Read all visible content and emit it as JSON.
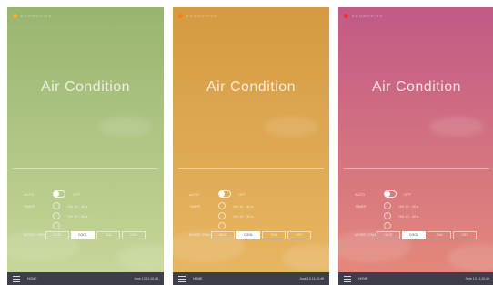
{
  "panels": [
    {
      "brand": "ECONOVIVE",
      "title": "Air Condition",
      "auto_label": "AUTO",
      "auto_state": "OFF",
      "timer_label": "TIMER",
      "time1": "ON  10 : 30 ▸",
      "time2": "ON  10 : 30 ▸",
      "mode_label": "MODE / FAN",
      "seg": [
        "HEAT",
        "COOL",
        "FAN",
        "DRY"
      ],
      "footer_home": "HOME",
      "footer_time": "June 13  11:10:48",
      "colors": {
        "top": "#98b56f",
        "bottom": "#c9d79a",
        "dot": "#ffb02e"
      }
    },
    {
      "brand": "ECONOVIVE",
      "title": "Air Condition",
      "auto_label": "AUTO",
      "auto_state": "OFF",
      "timer_label": "TIMER",
      "time1": "ON  10 : 30 ▸",
      "time2": "ON  10 : 30 ▸",
      "mode_label": "MODE / FAN",
      "seg": [
        "HEAT",
        "COOL",
        "FAN",
        "DRY"
      ],
      "footer_home": "HOME",
      "footer_time": "June 13  11:10:48",
      "colors": {
        "top": "#d59a42",
        "bottom": "#e8b763",
        "dot": "#ff7a1a"
      }
    },
    {
      "brand": "ECONOVIVE",
      "title": "Air Condition",
      "auto_label": "AUTO",
      "auto_state": "OFF",
      "timer_label": "TIMER",
      "time1": "ON  10 : 30 ▸",
      "time2": "ON  10 : 30 ▸",
      "mode_label": "MODE / FAN",
      "seg": [
        "HEAT",
        "COOL",
        "FAN",
        "DRY"
      ],
      "footer_home": "HOME",
      "footer_time": "June 13  11:10:48",
      "colors": {
        "top": "#c15a86",
        "bottom": "#e58a7a",
        "dot": "#ff2b2b"
      }
    }
  ]
}
